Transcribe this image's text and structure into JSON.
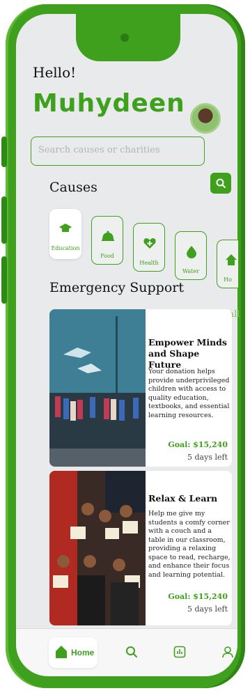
{
  "greeting": "Hello!",
  "user_name": "Muhydeen",
  "search": {
    "placeholder": "Search causes or charities"
  },
  "causes_heading": "Causes",
  "causes": [
    {
      "label": "Education",
      "icon": "graduation-cap-icon",
      "active": true
    },
    {
      "label": "Food",
      "icon": "cloche-icon"
    },
    {
      "label": "Health",
      "icon": "heart-plus-icon"
    },
    {
      "label": "Water",
      "icon": "water-drop-icon"
    },
    {
      "label": "Ho",
      "icon": "house-icon"
    }
  ],
  "emergency_heading": "Emergency Support",
  "see_all": "See all",
  "cards": [
    {
      "title": "Empower Minds and Shape Future",
      "description": "Your donation helps provide underprivileged children with access to quality education, textbooks, and essential learning resources.",
      "goal": "Goal: $15,240",
      "days_left": "5 days left"
    },
    {
      "title": "Relax & Learn",
      "description": "Help me give my students a comfy corner with a couch and a table in our classroom, providing a relaxing space to read, recharge, and enhance their focus and learning potential.",
      "goal": "Goal: $15,240",
      "days_left": "5 days left"
    }
  ],
  "nav": {
    "home_label": "Home"
  },
  "colors": {
    "accent": "#3ea01d",
    "background": "#e9eaec"
  }
}
